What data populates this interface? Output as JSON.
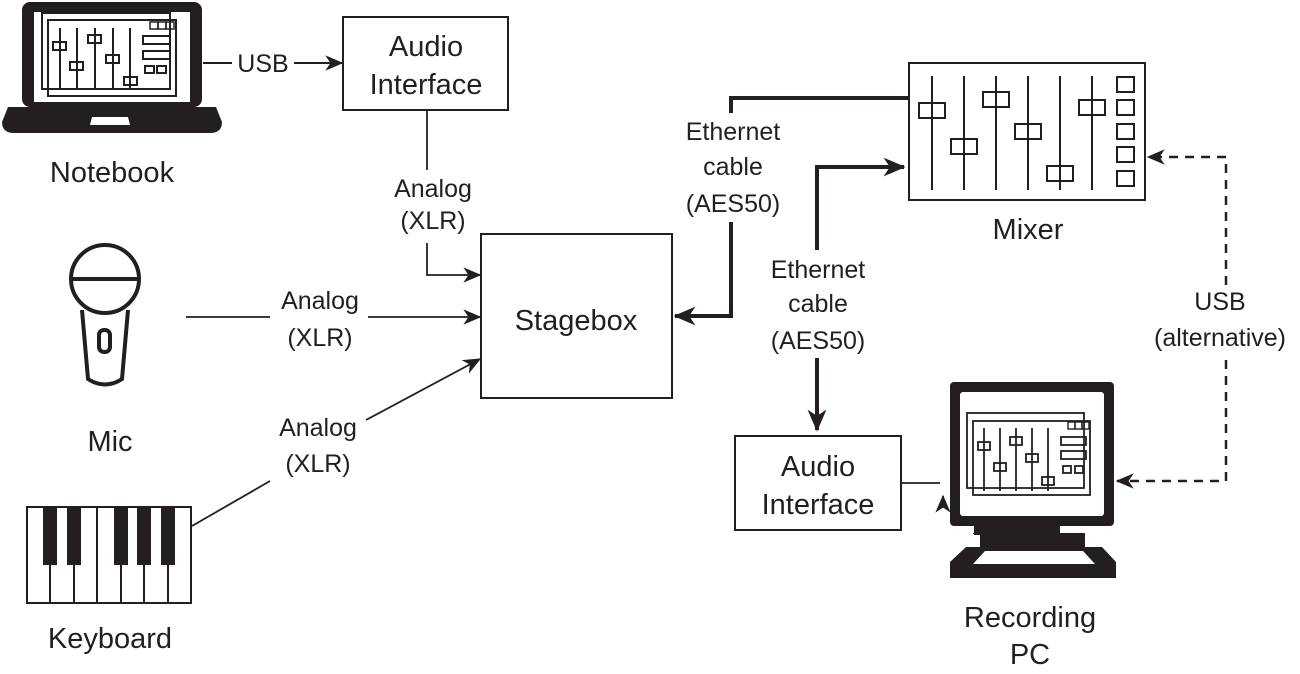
{
  "diagram": {
    "type": "audio signal flow",
    "colors": {
      "ink": "#231f20",
      "background": "#ffffff"
    },
    "nodes": {
      "notebook": {
        "label": "Notebook",
        "icon": "laptop-icon"
      },
      "audio_interface_1": {
        "line1": "Audio",
        "line2": "Interface"
      },
      "mic": {
        "label": "Mic",
        "icon": "microphone-icon"
      },
      "keyboard": {
        "label": "Keyboard",
        "icon": "piano-keyboard-icon"
      },
      "stagebox": {
        "label": "Stagebox"
      },
      "mixer": {
        "label": "Mixer",
        "icon": "mixer-console-icon"
      },
      "audio_interface_2": {
        "line1": "Audio",
        "line2": "Interface"
      },
      "recording_pc": {
        "line1": "Recording",
        "line2": "PC",
        "icon": "desktop-computer-icon"
      }
    },
    "edges": {
      "notebook_to_interface": {
        "label": "USB",
        "style": "solid"
      },
      "interface_to_stagebox": {
        "line1": "Analog",
        "line2": "(XLR)",
        "style": "solid"
      },
      "mic_to_stagebox": {
        "line1": "Analog",
        "line2": "(XLR)",
        "style": "solid"
      },
      "keyboard_to_stagebox": {
        "line1": "Analog",
        "line2": "(XLR)",
        "style": "solid"
      },
      "mixer_to_stagebox": {
        "line1": "Ethernet",
        "line2": "cable",
        "line3": "(AES50)",
        "style": "thick"
      },
      "interface2_to_mixer": {
        "line1": "Ethernet",
        "line2": "cable",
        "line3": "(AES50)",
        "style": "thick"
      },
      "pc_mixer_usb": {
        "line1": "USB",
        "line2": "(alternative)",
        "style": "dashed"
      }
    }
  }
}
